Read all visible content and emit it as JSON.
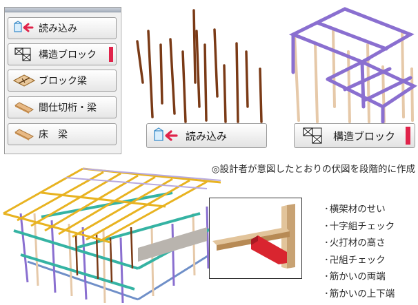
{
  "menu": {
    "items": [
      {
        "label": "読み込み",
        "icon": "load-arrow-icon"
      },
      {
        "label": "構造ブロック",
        "icon": "structure-block-icon",
        "active": true
      },
      {
        "label": "ブロック梁",
        "icon": "block-beam-icon"
      },
      {
        "label": "間仕切桁・梁",
        "icon": "partition-girder-icon"
      },
      {
        "label": "床　梁",
        "icon": "floor-beam-icon"
      }
    ],
    "active_marker_color": "#e0234a"
  },
  "buttons": {
    "load_label": "読み込み",
    "structure_block_label": "構造ブロック"
  },
  "caption": "◎設計者が意図したとおりの伏図を段階的に作成",
  "checklist": [
    "横架材のせい",
    "十字組チェック",
    "火打材の高さ",
    "卍組チェック",
    "筋かいの両端",
    "筋かいの上下端"
  ],
  "colors": {
    "post_brown": "#7a3a16",
    "frame_purple": "#8a6fd0",
    "frame_beige": "#e6c9a9",
    "roof_yellow": "#e8b321",
    "teal": "#35b3a3",
    "accent_red": "#d9252f"
  }
}
